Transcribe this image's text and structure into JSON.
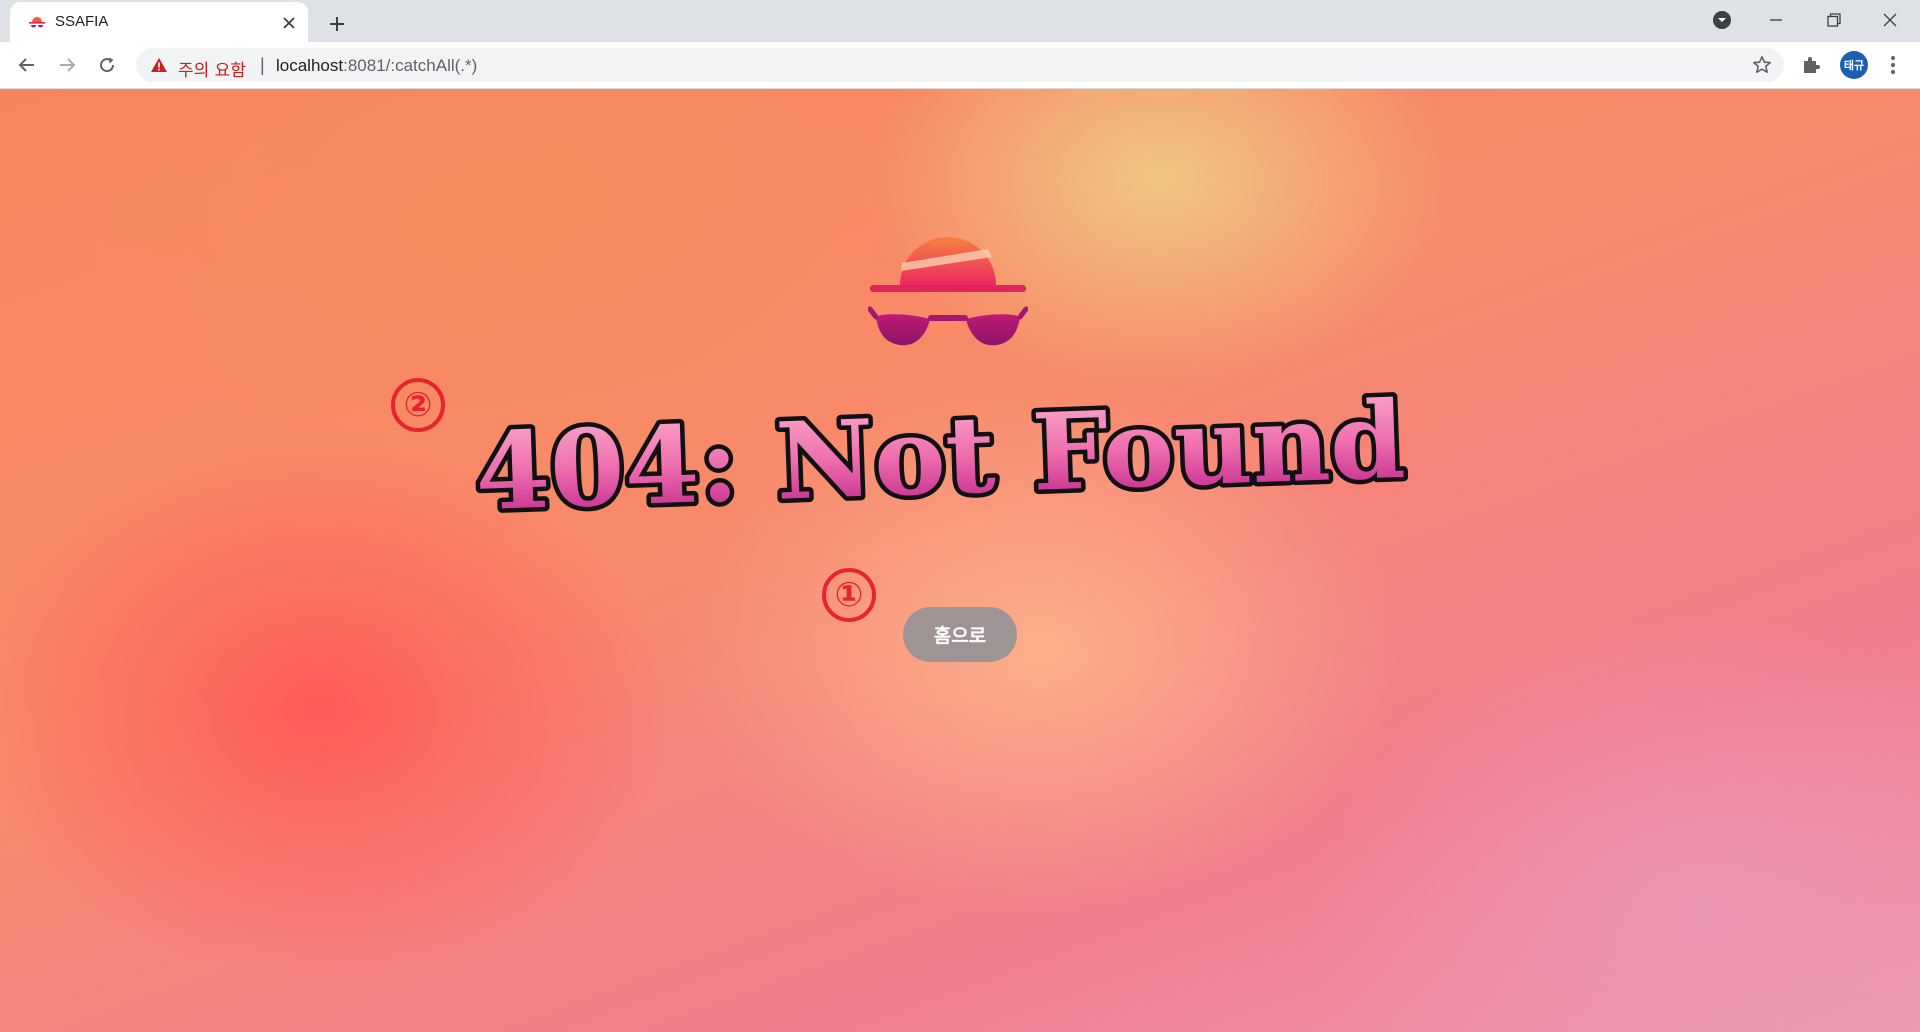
{
  "browser": {
    "tab": {
      "title": "SSAFIA"
    },
    "address_bar": {
      "security_label": "주의 요함",
      "separator": "|",
      "url_host": "localhost",
      "url_path": ":8081/:catchAll(.*)"
    },
    "profile_initials": "태규",
    "icons": {
      "tab_close": "close-icon",
      "new_tab": "plus-icon",
      "back": "arrow-left-icon",
      "forward": "arrow-right-icon",
      "reload": "reload-icon",
      "warning": "warning-triangle-icon",
      "bookmark": "star-icon",
      "extensions": "puzzle-icon",
      "menu": "kebab-menu-icon",
      "tab_search": "tab-search-icon",
      "minimize": "minimize-icon",
      "restore": "restore-icon",
      "close_window": "close-icon"
    },
    "colors": {
      "warning": "#c5221f",
      "avatar": "#1a5fb4"
    }
  },
  "page": {
    "heading": "404: Not Found",
    "home_button_label": "홈으로",
    "annotation_markers": [
      "①",
      "②"
    ],
    "colors": {
      "heading_top": "#f9a0c6",
      "heading_bottom": "#c01a8a",
      "marker": "#e8232f",
      "logo_hat": "#f25a3c",
      "logo_glasses": "#a3186f"
    }
  }
}
